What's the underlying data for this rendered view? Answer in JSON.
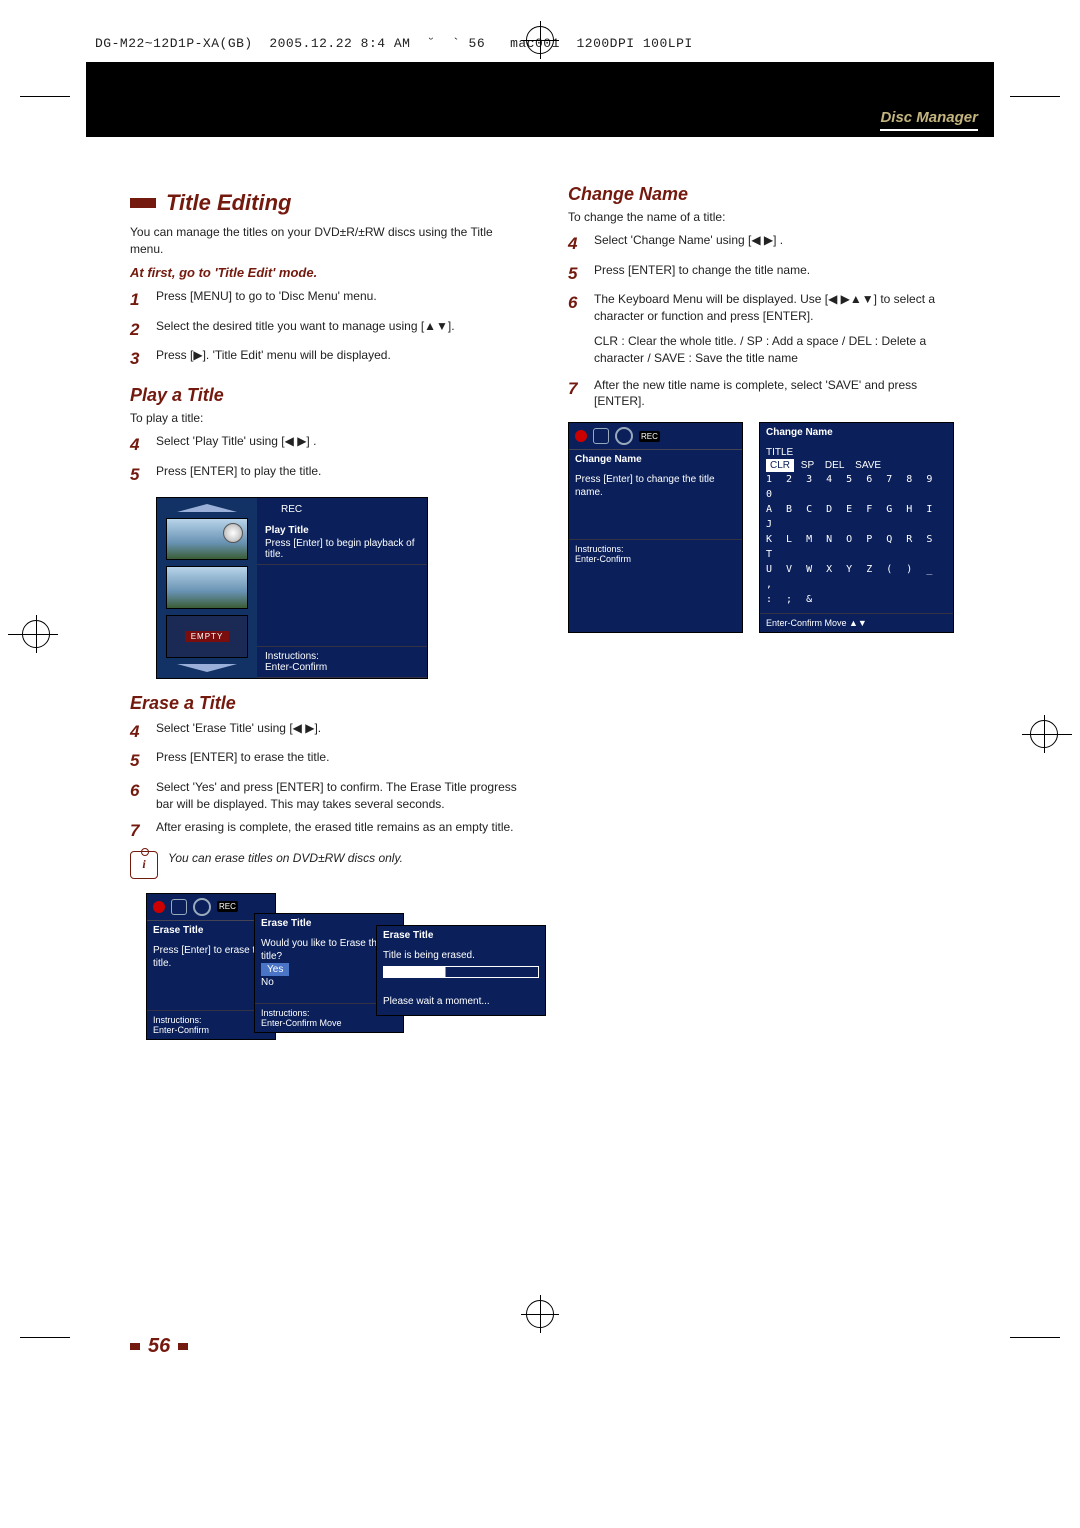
{
  "header": {
    "runline": "DG-M22~12D1P-XA(GB)  2005.12.22 8:4 AM  ˘  ` 56   mac001  1200DPI 100LPI",
    "band_label": "Disc Manager"
  },
  "page_number": "56",
  "left": {
    "title_editing_heading": "Title Editing",
    "title_editing_intro": "You can manage the titles on your DVD±R/±RW discs using the Title menu.",
    "mode_line": "At first, go to 'Title Edit' mode.",
    "steps_mode": {
      "1": "Press [MENU] to go to 'Disc Menu' menu.",
      "2": "Select the desired title you want to manage using [▲▼].",
      "3": "Press [▶]. 'Title Edit' menu will be displayed."
    },
    "play_heading": "Play a Title",
    "play_intro": "To play a title:",
    "play_steps": {
      "4": "Select 'Play Title' using [◀ ▶] .",
      "5": "Press [ENTER] to play the title."
    },
    "osd_play": {
      "section_label": "Play Title",
      "section_body": "Press [Enter] to begin playback of title.",
      "empty_label": "EMPTY",
      "instructions_label": "Instructions:",
      "instructions_body": "Enter-Confirm"
    },
    "erase_heading": "Erase a Title",
    "erase_steps": {
      "4": "Select 'Erase Title' using [◀ ▶].",
      "5": "Press [ENTER] to erase the title.",
      "6": "Select 'Yes' and press [ENTER] to confirm. The Erase Title progress bar will be displayed. This may takes several seconds.",
      "7": "After erasing is complete, the erased title remains as an empty title."
    },
    "erase_note": "You can erase titles on DVD±RW discs only.",
    "osd_erase": {
      "box1_head": "Erase Title",
      "box1_body": "Press [Enter] to erase this title.",
      "box1_instr_label": "Instructions:",
      "box1_instr_body": "Enter-Confirm",
      "box2_head": "Erase Title",
      "box2_body": "Would you like to Erase the title?",
      "box2_yes": "Yes",
      "box2_no": "No",
      "box2_instr_label": "Instructions:",
      "box2_instr_body": "Enter-Confirm  Move",
      "box3_head": "Erase Title",
      "box3_body": "Title is being erased.",
      "box3_wait": "Please wait a moment..."
    }
  },
  "right": {
    "cn_heading": "Change Name",
    "cn_intro": "To change the name of a title:",
    "cn_steps": {
      "4": "Select 'Change Name' using [◀ ▶] .",
      "5": "Press [ENTER] to change the title name.",
      "6": "The Keyboard Menu will be displayed. Use [◀ ▶▲▼] to select a character or function and press [ENTER].",
      "6b": "CLR : Clear the whole title. / SP : Add a space / DEL : Delete a character / SAVE : Save the title name",
      "7": "After the new title name is complete, select 'SAVE' and press [ENTER]."
    },
    "osd_cn": {
      "box1_head": "Change Name",
      "box1_body": "Press [Enter] to change the title name.",
      "box1_instr_label": "Instructions:",
      "box1_instr_body": "Enter-Confirm",
      "box2_head": "Change Name",
      "kbd_title": "TITLE",
      "kbd_row0_clr": "CLR",
      "kbd_row0_sp": "SP",
      "kbd_row0_del": "DEL",
      "kbd_row0_save": "SAVE",
      "kbd_row1": "1 2 3 4 5 6 7 8 9 0",
      "kbd_row2": "A B C D E F G H I J",
      "kbd_row3": "K L M N O P Q R S T",
      "kbd_row4": "U V W X Y Z ( ) _ ,",
      "kbd_row5": ": ; &",
      "box2_instr": "Enter-Confirm  Move ▲▼"
    }
  }
}
